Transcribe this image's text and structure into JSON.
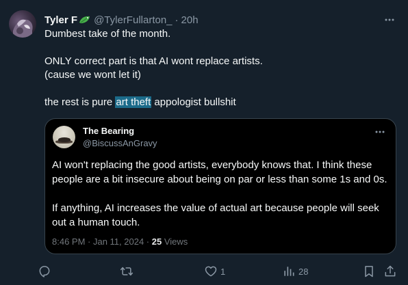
{
  "tweet": {
    "author_name": "Tyler F",
    "author_handle": "@TylerFullarton_",
    "separator": "·",
    "time": "20h",
    "text_lines": [
      "Dumbest take of the month.",
      "ONLY correct part is that AI wont replace artists.",
      "(cause we wont let it)",
      "the rest is pure",
      "art theft",
      "appologist bullshit"
    ]
  },
  "quote": {
    "author_name": "The Bearing",
    "author_handle": "@BiscussAnGravy",
    "paragraph1": "AI won't replacing the good artists, everybody knows that. I think these people are a bit insecure about being on par or less than some 1s and 0s.",
    "paragraph2": "If anything, AI increases the value of actual art because people will seek out a human touch.",
    "timestamp": "8:46 PM · Jan 11, 2024 ·",
    "views_count": "25",
    "views_label": "Views"
  },
  "actions": {
    "reply_count": "",
    "retweet_count": "",
    "like_count": "1",
    "views_count": "28"
  },
  "colors": {
    "background": "#15202b",
    "quote_background": "#000000",
    "text": "#f7f9f9",
    "secondary": "#8b98a5",
    "highlight": "#1c6b8a",
    "border": "#38444d"
  },
  "icons": {
    "name_badge": "green-leaf-emoji",
    "more": "more-icon",
    "reply": "reply-icon",
    "retweet": "retweet-icon",
    "like": "heart-icon",
    "views": "views-icon",
    "bookmark": "bookmark-icon",
    "share": "share-icon"
  }
}
